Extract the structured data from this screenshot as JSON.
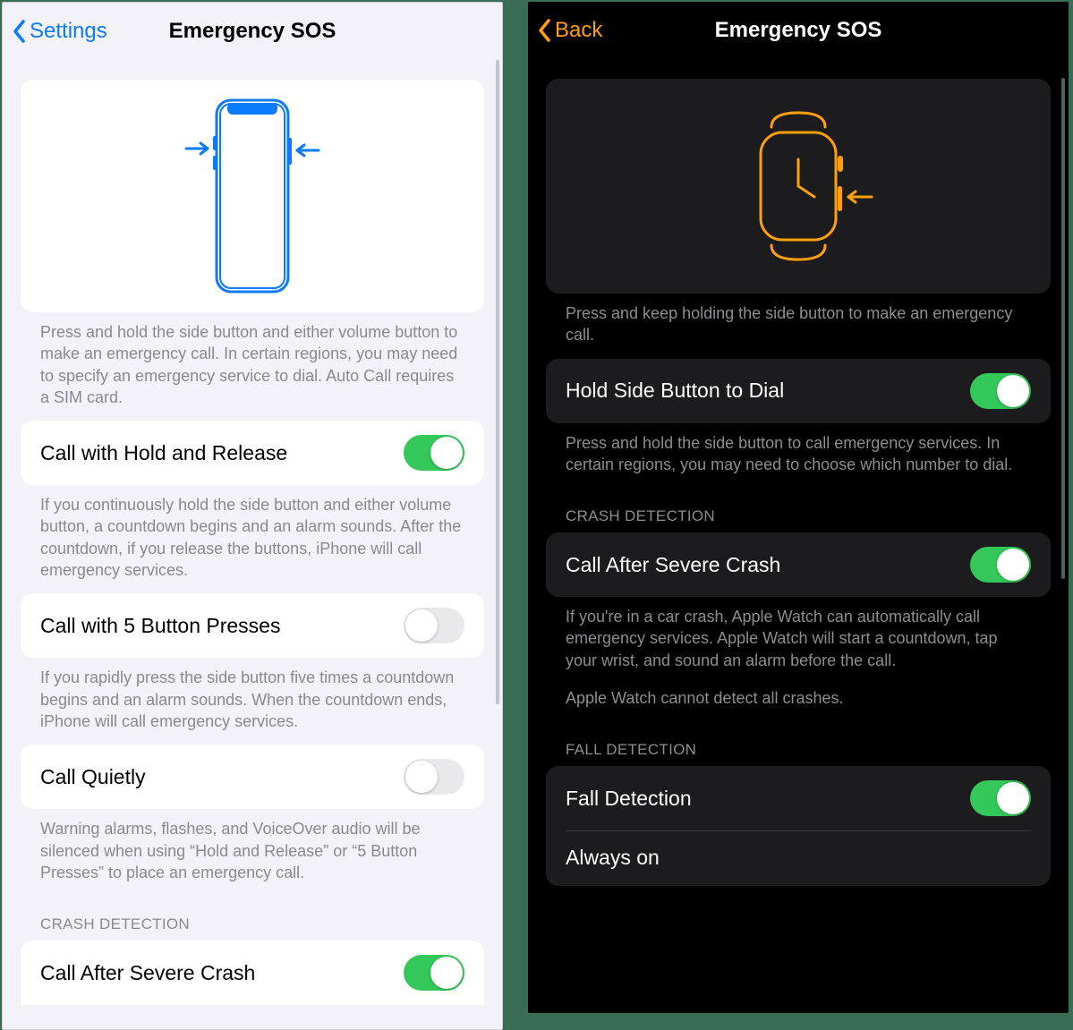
{
  "iphone": {
    "back_label": "Settings",
    "title": "Emergency SOS",
    "hero_footer": "Press and hold the side button and either volume button to make an emergency call. In certain regions, you may need to specify an emergency service to dial. Auto Call requires a SIM card.",
    "rows": {
      "hold_release": {
        "label": "Call with Hold and Release",
        "on": true,
        "footer": "If you continuously hold the side button and either volume button, a countdown begins and an alarm sounds. After the countdown, if you release the buttons, iPhone will call emergency services."
      },
      "five_presses": {
        "label": "Call with 5 Button Presses",
        "on": false,
        "footer": "If you rapidly press the side button five times a countdown begins and an alarm sounds. When the countdown ends, iPhone will call emergency services."
      },
      "call_quietly": {
        "label": "Call Quietly",
        "on": false,
        "footer": "Warning alarms, flashes, and VoiceOver audio will be silenced when using “Hold and Release” or “5 Button Presses” to place an emergency call."
      }
    },
    "crash_section": "CRASH DETECTION",
    "crash_row": {
      "label": "Call After Severe Crash",
      "on": true
    }
  },
  "watch": {
    "back_label": "Back",
    "title": "Emergency SOS",
    "hero_footer": "Press and keep holding the side button to make an emergency call.",
    "hold_row": {
      "label": "Hold Side Button to Dial",
      "on": true,
      "footer": "Press and hold the side button to call emergency services. In certain regions, you may need to choose which number to dial."
    },
    "crash_section": "CRASH DETECTION",
    "crash_row": {
      "label": "Call After Severe Crash",
      "on": true,
      "footer": "If you're in a car crash, Apple Watch can automatically call emergency services. Apple Watch will start a countdown, tap your wrist, and sound an alarm before the call.",
      "footer2": "Apple Watch cannot detect all crashes."
    },
    "fall_section": "FALL DETECTION",
    "fall_row": {
      "label": "Fall Detection",
      "on": true
    },
    "always_on": "Always on"
  }
}
